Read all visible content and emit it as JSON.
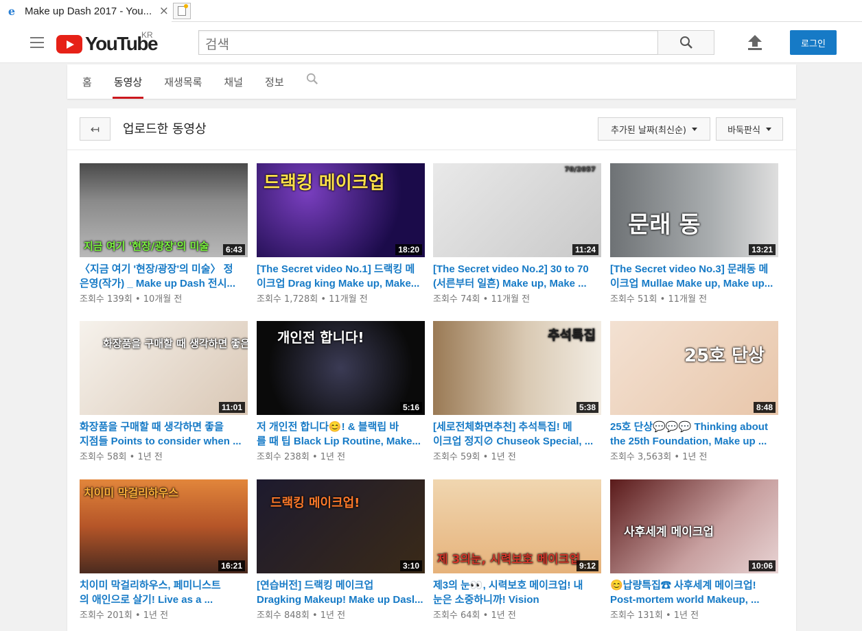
{
  "browser": {
    "tab_title": "Make up Dash 2017 - You...",
    "close_glyph": "×"
  },
  "masthead": {
    "logo_text": "YouTube",
    "region": "KR",
    "search_placeholder": "검색",
    "login_label": "로그인"
  },
  "channel_nav": {
    "tabs": [
      {
        "label": "홈",
        "active": false
      },
      {
        "label": "동영상",
        "active": true
      },
      {
        "label": "재생목록",
        "active": false
      },
      {
        "label": "채널",
        "active": false
      },
      {
        "label": "정보",
        "active": false
      }
    ]
  },
  "section": {
    "back_glyph": "↤",
    "title": "업로드한 동영상",
    "sort_label": "추가된 날짜(최신순)",
    "view_label": "바둑판식"
  },
  "videos": [
    {
      "line1": "〈지금 여기 '현장/광장'의 미술〉 정",
      "line2": "은영(작가) _ Make up Dash 전시...",
      "views": "조회수 139회",
      "age": "10개월 전",
      "duration": "6:43",
      "caption": "지금 여기 '현장/광장'의 미술"
    },
    {
      "line1": "[The Secret video No.1] 드랙킹 메",
      "line2": "이크업 Drag king Make up, Make...",
      "views": "조회수 1,728회",
      "age": "11개월 전",
      "duration": "18:20",
      "caption": "드랙킹 메이크업"
    },
    {
      "line1": "[The Secret video No.2] 30 to 70",
      "line2": "(서른부터 일흔) Make up, Make ...",
      "views": "조회수 74회",
      "age": "11개월 전",
      "duration": "11:24",
      "caption": "70/2057"
    },
    {
      "line1": "[The Secret video No.3] 문래동 메",
      "line2": "이크업 Mullae Make up, Make up...",
      "views": "조회수 51회",
      "age": "11개월 전",
      "duration": "13:21",
      "caption": "문래 동"
    },
    {
      "line1": "화장품을 구매할 때 생각하면 좋을",
      "line2": "지점들 Points to consider when ...",
      "views": "조회수 58회",
      "age": "1년 전",
      "duration": "11:01",
      "caption": "화장품을 구매할 때 생각하면 좋은 지점들"
    },
    {
      "line1": "저 개인전 합니다😊! & 블랙립 바",
      "line2": "를 때 팁 Black Lip Routine, Make...",
      "views": "조회수 238회",
      "age": "1년 전",
      "duration": "5:16",
      "caption": "개인전 합니다!"
    },
    {
      "line1": "[세로전체화면추천] 추석특집! 메",
      "line2": "이크업 정지⊘ Chuseok Special, ...",
      "views": "조회수 59회",
      "age": "1년 전",
      "duration": "5:38",
      "caption": "추석특집"
    },
    {
      "line1": "25호 단상💬💬💬 Thinking about",
      "line2": "the 25th Foundation, Make up    ...",
      "views": "조회수 3,563회",
      "age": "1년 전",
      "duration": "8:48",
      "caption": "25호 단상"
    },
    {
      "line1": "치이미 막걸리하우스, 페미니스트",
      "line2": "의 애인으로 살기! Live as a     ...",
      "views": "조회수 201회",
      "age": "1년 전",
      "duration": "16:21",
      "caption": "치이미 막걸리하우스"
    },
    {
      "line1": "[연습버전] 드랙킹 메이크업",
      "line2": "Dragking Makeup! Make up Dasl...",
      "views": "조회수 848회",
      "age": "1년 전",
      "duration": "3:10",
      "caption": "드랙킹 메이크업!"
    },
    {
      "line1": "제3의 눈👀, 시력보호 메이크업! 내",
      "line2": "눈은 소중하니까! Vision",
      "views": "조회수 64회",
      "age": "1년 전",
      "duration": "9:12",
      "caption": "제 3의눈, 시력보호 메이크업"
    },
    {
      "line1": "😊납량특집☎ 사후세계 메이크업!",
      "line2": "Post-mortem world Makeup,       ...",
      "views": "조회수 131회",
      "age": "1년 전",
      "duration": "10:06",
      "caption": "사후세계 메이크업"
    }
  ],
  "meta_separator": "•",
  "colors": {
    "brand_red": "#e62117",
    "link_blue": "#167ac6",
    "login_blue": "#167ac6",
    "active_tab_underline": "#cc181e"
  }
}
